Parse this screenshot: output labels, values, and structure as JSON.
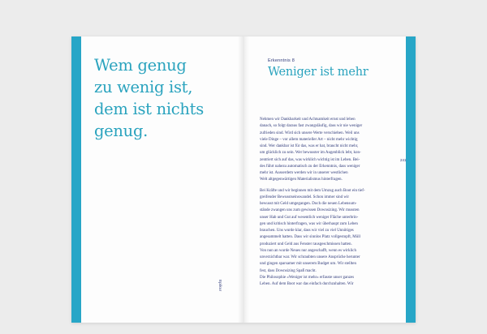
{
  "left_page": {
    "quote_lines": [
      "Wem genug",
      "zu wenig ist,",
      "dem ist nichts",
      "genug."
    ],
    "side_label": "Epikur"
  },
  "right_page": {
    "chapter_label": "Erkenntnis 8",
    "chapter_title": "Weniger ist mehr",
    "page_number": "241",
    "paragraph_1": [
      "Nehmen wir Dankbarkeit und Achtsamkeit ernst und leben",
      "danach, so folgt daraus fast zwangsläufig, dass wir nie weniger",
      "zufrieden sind. Wird sich unsere Werte verschieben. Weil uns",
      "viele Dinge – vor allem materieller Art – nicht mehr wichtig",
      "sind. Wer dankbar ist für das, was er hat, braucht nicht mehr,",
      "um glücklich zu sein. Wer bewusster im Augenblick lebt, kon-",
      "zentriert sich auf das, was wirklich wichtig ist im Leben. Bei-",
      "des führt nahezu automatisch zu der Erkenntnis, dass weniger",
      "mehr ist. Ausserdem werden wir in unserer westlichen",
      "Welt altgegenwärtigen Materialismus hinterfragen."
    ],
    "paragraph_2": [
      "Bei Kräfte und wir beginnen mit dem Umzug auch Boot ein tief-",
      "greifender Bewusstseinswandel. Schon immer sind wir",
      "bewusst mit Geld umgegangen. Doch die neuen Lebensum-",
      "stände zwangen uns zum gewissen Downsizing. Wir mussten",
      "unser Hab und Gut auf wesentlich weniger Fläche unterbrin-",
      "gen und kritisch hinterfragen, was wir überhaupt zum Leben",
      "brauchen. Uns wurde klar, dass wir viel zu viel Unnötiges",
      "angesammelt hatten. Dass wir sinnlos Platz vollgestopft, Müll",
      "produziert und Geld aus Fenster rausgeschmissen hatten.",
      "Von nun an wurde Neues nur angeschafft, wenn es wirklich",
      "unverzichtbar war. Wir schraubten unsere Ansprüche herunter",
      "und gingen sparsamer mit unserem Budget um. Wir stellten",
      "fest, dass Downsizing Spaß macht.",
      "Die Philosophie »Weniger ist mehr« erfasste unser ganzes",
      "Leben. Auf dem Boot war das einfach durchzuhalten. Wir"
    ]
  }
}
